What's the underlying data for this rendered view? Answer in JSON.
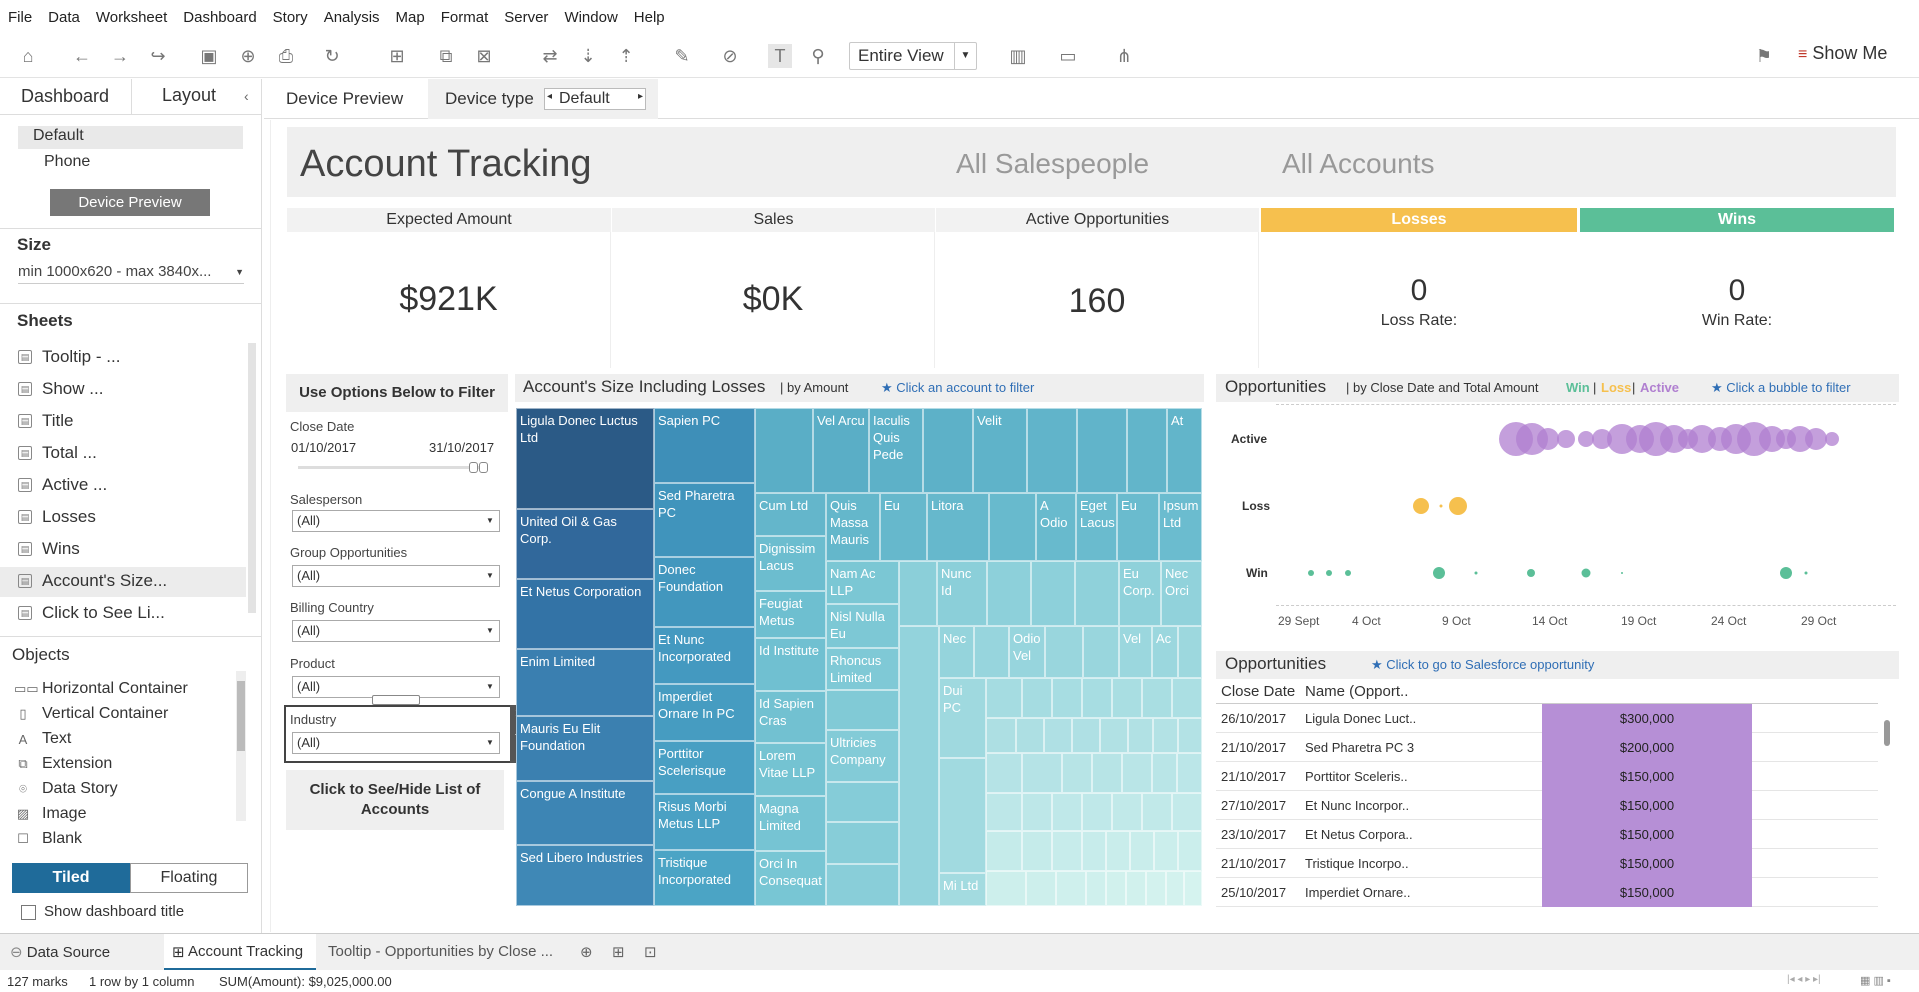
{
  "menu": [
    "File",
    "Data",
    "Worksheet",
    "Dashboard",
    "Story",
    "Analysis",
    "Map",
    "Format",
    "Server",
    "Window",
    "Help"
  ],
  "toolbar": {
    "view_mode": "Entire View",
    "show_me": "Show Me"
  },
  "left_panel": {
    "tabs": [
      "Dashboard",
      "Layout"
    ],
    "device_default": "Default",
    "device_phone": "Phone",
    "device_preview_button": "Device Preview",
    "size_title": "Size",
    "size_value": "min 1000x620 - max 3840x...",
    "sheets_title": "Sheets",
    "sheets": [
      "Tooltip - ...",
      "Show ...",
      "Title",
      "Total ...",
      "Active ...",
      "Losses",
      "Wins",
      "Account's Size...",
      "Click to See Li..."
    ],
    "objects_title": "Objects",
    "objects": [
      "Horizontal Container",
      "Vertical Container",
      "Text",
      "Extension",
      "Data Story",
      "Image",
      "Blank"
    ],
    "tiled": "Tiled",
    "floating": "Floating",
    "show_title": "Show dashboard title"
  },
  "device_bar": {
    "preview": "Device Preview",
    "type_label": "Device type",
    "type_value": "Default"
  },
  "dashboard": {
    "title": "Account Tracking",
    "salespeople": "All Salespeople",
    "accounts": "All Accounts",
    "kpis": {
      "expected_label": "Expected Amount",
      "expected_value": "$921K",
      "sales_label": "Sales",
      "sales_value": "$0K",
      "active_label": "Active Opportunities",
      "active_value": "160",
      "losses_label": "Losses",
      "losses_value": "0",
      "loss_rate_label": "Loss Rate:",
      "wins_label": "Wins",
      "wins_value": "0",
      "win_rate_label": "Win Rate:"
    },
    "filters": {
      "header": "Use Options Below to Filter",
      "close_date_label": "Close Date",
      "close_date_start": "01/10/2017",
      "close_date_end": "31/10/2017",
      "salesperson_label": "Salesperson",
      "salesperson_value": "(All)",
      "group_label": "Group Opportunities",
      "group_value": "(All)",
      "billing_label": "Billing Country",
      "billing_value": "(All)",
      "product_label": "Product",
      "product_value": "(All)",
      "industry_label": "Industry",
      "industry_value": "(All)",
      "toggle_list": "Click to See/Hide List of Accounts"
    },
    "treemap": {
      "title": "Account's Size Including Losses",
      "subtitle": "| by Amount",
      "hint": "★ Click an account to filter",
      "cells": [
        "Ligula Donec Luctus Ltd",
        "United Oil & Gas Corp.",
        "Et Netus Corporation",
        "Enim Limited",
        "Mauris Eu Elit Foundation",
        "Congue A Institute",
        "Sed Libero Industries",
        "Sapien PC",
        "Sed Pharetra PC",
        "Donec Foundation",
        "Et Nunc Incorporated",
        "Imperdiet Ornare In PC",
        "Porttitor Scelerisque",
        "Risus Morbi Metus LLP",
        "Tristique Incorporated",
        "Vel Arcu",
        "Iaculis Quis Pede",
        "Velit",
        "At",
        "Cum Ltd",
        "Quis Massa Mauris",
        "Eu",
        "Litora",
        "A Odio",
        "Eget Lacus",
        "Eu",
        "Ipsum Ltd",
        "Dignissim Lacus",
        "Feugiat Metus",
        "Id Institute",
        "Id Sapien Cras",
        "Lorem Vitae LLP",
        "Magna Limited",
        "Orci In Consequat",
        "Nam Ac LLP",
        "Nisl Nulla Eu",
        "Rhoncus Limited",
        "Ultricies Company",
        "Nunc Id",
        "Eu Corp.",
        "Nec Orci",
        "Nec",
        "Odio Vel",
        "Vel",
        "Ac",
        "Dui PC",
        "Mi Ltd"
      ]
    },
    "bubble": {
      "title": "Opportunities",
      "subtitle": "| by Close Date and Total Amount",
      "legend_win": "Win",
      "legend_sep1": "|",
      "legend_loss": "Loss",
      "legend_sep2": "|",
      "legend_active": "Active",
      "hint": "★ Click a bubble to filter",
      "rows": [
        "Active",
        "Loss",
        "Win"
      ],
      "ticks": [
        "29 Sept",
        "4 Oct",
        "9 Oct",
        "14 Oct",
        "19 Oct",
        "24 Oct",
        "29 Oct"
      ],
      "colors": {
        "win": "#5bbf98",
        "loss": "#f6c04e",
        "active": "#b07fd0"
      }
    },
    "opp_table": {
      "title": "Opportunities",
      "hint": "★ Click to go to Salesforce opportunity",
      "col_date": "Close Date",
      "col_name": "Name (Opport..",
      "rows": [
        {
          "date": "26/10/2017",
          "name": "Ligula Donec Luct..",
          "amount": "$300,000"
        },
        {
          "date": "21/10/2017",
          "name": "Sed Pharetra PC 3",
          "amount": "$200,000"
        },
        {
          "date": "21/10/2017",
          "name": "Porttitor Sceleris..",
          "amount": "$150,000"
        },
        {
          "date": "27/10/2017",
          "name": "Et Nunc Incorpor..",
          "amount": "$150,000"
        },
        {
          "date": "23/10/2017",
          "name": "Et Netus Corpora..",
          "amount": "$150,000"
        },
        {
          "date": "21/10/2017",
          "name": "Tristique Incorpo..",
          "amount": "$150,000"
        },
        {
          "date": "25/10/2017",
          "name": "Imperdiet Ornare..",
          "amount": "$150,000"
        }
      ]
    }
  },
  "sheet_tabs": {
    "data_source": "Data Source",
    "account_tracking": "Account Tracking",
    "tooltip": "Tooltip - Opportunities by Close ..."
  },
  "status": {
    "marks": "127 marks",
    "rows": "1 row by 1 column",
    "sum": "SUM(Amount): $9,025,000.00"
  }
}
